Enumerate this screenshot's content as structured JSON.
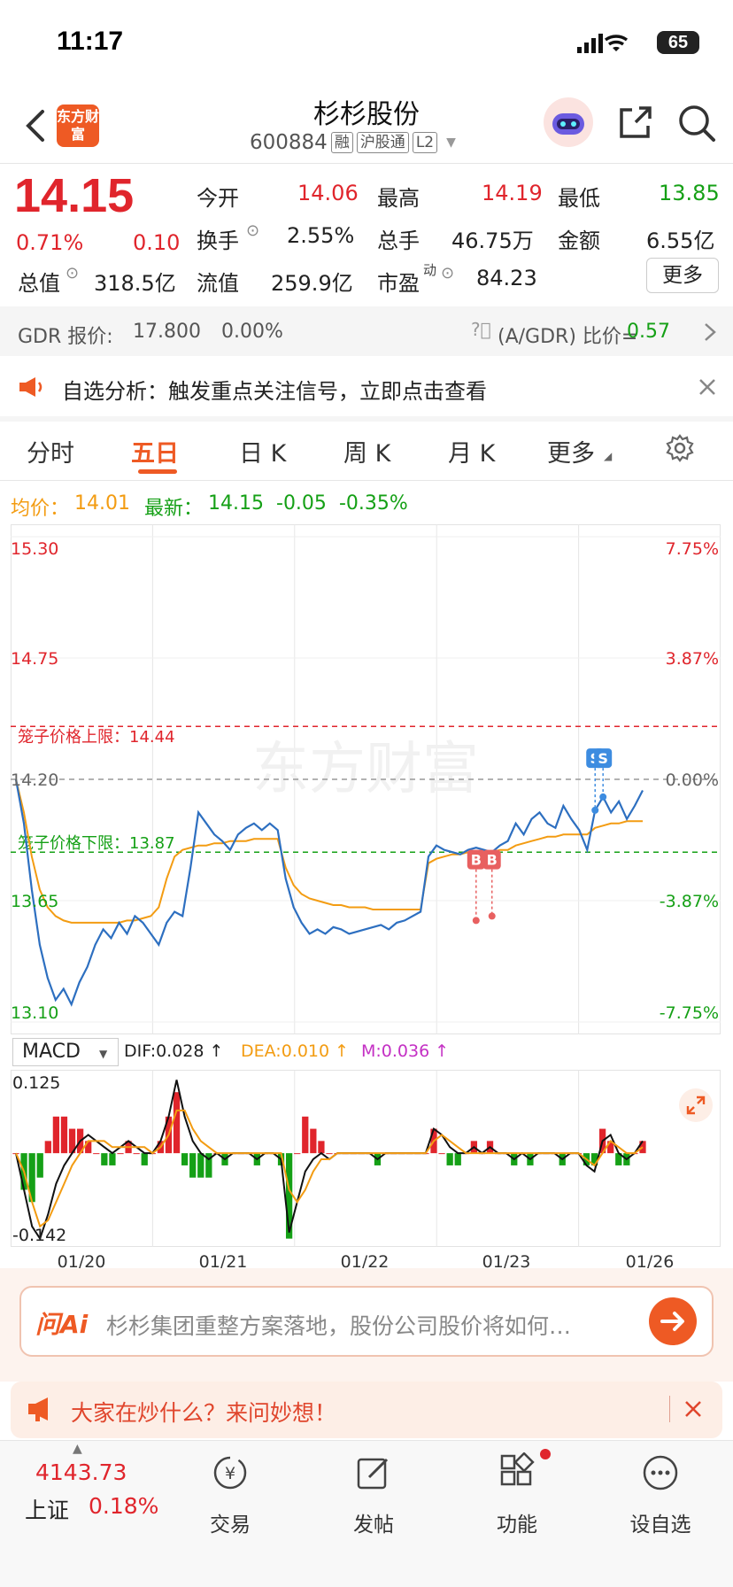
{
  "status": {
    "time": "11:17",
    "battery": "65"
  },
  "header": {
    "title": "杉杉股份",
    "code": "600884",
    "tags": [
      "融",
      "沪股通",
      "L2"
    ],
    "logo_text": "东方财富"
  },
  "quote": {
    "price": "14.15",
    "change_pct": "0.71%",
    "change": "0.10",
    "stats": [
      {
        "label": "今开",
        "value": "14.06",
        "color": "#e0252c"
      },
      {
        "label": "最高",
        "value": "14.19",
        "color": "#e0252c"
      },
      {
        "label": "最低",
        "value": "13.85",
        "color": "#15a016"
      },
      {
        "label": "换手",
        "value": "2.55%",
        "color": "#222"
      },
      {
        "label": "总手",
        "value": "46.75万",
        "color": "#222"
      },
      {
        "label": "金额",
        "value": "6.55亿",
        "color": "#222"
      },
      {
        "label": "总值",
        "value": "318.5亿",
        "color": "#222"
      },
      {
        "label": "流值",
        "value": "259.9亿",
        "color": "#222"
      },
      {
        "label": "市盈",
        "label_sup": "动",
        "value": "84.23",
        "color": "#222"
      }
    ],
    "more_label": "更多"
  },
  "gdr": {
    "label": "GDR 报价:",
    "price": "17.800",
    "pct": "0.00%",
    "ratio_label": "(A/GDR) 比价=",
    "ratio": "0.57"
  },
  "notice": {
    "text": "自选分析：触发重点关注信号，立即点击查看"
  },
  "tabs": [
    "分时",
    "五日",
    "日 K",
    "周 K",
    "月 K",
    "更多"
  ],
  "active_tab": "五日",
  "chart_info": {
    "avg_label": "均价：",
    "avg": "14.01",
    "latest_label": "最新：",
    "latest": "14.15",
    "chg": "-0.05",
    "chg_pct": "-0.35%"
  },
  "chart_data": {
    "type": "line",
    "y_left_ticks": [
      "15.30",
      "14.75",
      "14.20",
      "13.65",
      "13.10"
    ],
    "y_right_ticks": [
      "7.75%",
      "3.87%",
      "0.00%",
      "-3.87%",
      "-7.75%"
    ],
    "ylim": [
      13.1,
      15.3
    ],
    "upper_limit_label": "笼子价格上限：14.44",
    "upper_limit": 14.44,
    "lower_limit_label": "笼子价格下限：13.87",
    "lower_limit": 13.87,
    "base_price": 14.2,
    "x_labels": [
      "01/20",
      "01/21",
      "01/22",
      "01/23",
      "01/26"
    ],
    "watermark": "东方财富",
    "series": [
      {
        "name": "最新",
        "color": "#2d6fc0",
        "values": [
          14.2,
          14.0,
          13.7,
          13.45,
          13.3,
          13.2,
          13.25,
          13.18,
          13.28,
          13.35,
          13.45,
          13.52,
          13.48,
          13.55,
          13.5,
          13.58,
          13.55,
          13.5,
          13.45,
          13.55,
          13.6,
          13.58,
          13.8,
          14.05,
          14.0,
          13.95,
          13.92,
          13.88,
          13.95,
          13.98,
          14.0,
          13.97,
          14.0,
          13.97,
          13.75,
          13.62,
          13.55,
          13.5,
          13.52,
          13.5,
          13.53,
          13.52,
          13.5,
          13.51,
          13.52,
          13.53,
          13.54,
          13.52,
          13.55,
          13.56,
          13.58,
          13.6,
          13.85,
          13.9,
          13.88,
          13.87,
          13.86,
          13.88,
          13.89,
          13.88,
          13.87,
          13.9,
          13.92,
          14.0,
          13.95,
          14.02,
          14.05,
          14.0,
          13.98,
          14.08,
          14.02,
          13.97,
          13.88,
          14.06,
          14.12,
          14.05,
          14.1,
          14.02,
          14.08,
          14.15
        ]
      },
      {
        "name": "均价",
        "color": "#f39c12",
        "values": [
          14.2,
          14.05,
          13.85,
          13.7,
          13.62,
          13.58,
          13.56,
          13.55,
          13.55,
          13.55,
          13.55,
          13.55,
          13.55,
          13.55,
          13.56,
          13.56,
          13.57,
          13.58,
          13.62,
          13.75,
          13.85,
          13.88,
          13.89,
          13.9,
          13.9,
          13.91,
          13.91,
          13.92,
          13.92,
          13.92,
          13.93,
          13.93,
          13.93,
          13.93,
          13.8,
          13.72,
          13.68,
          13.66,
          13.65,
          13.64,
          13.63,
          13.63,
          13.62,
          13.62,
          13.62,
          13.61,
          13.61,
          13.61,
          13.61,
          13.61,
          13.61,
          13.61,
          13.82,
          13.84,
          13.85,
          13.86,
          13.86,
          13.87,
          13.87,
          13.87,
          13.87,
          13.88,
          13.88,
          13.9,
          13.91,
          13.92,
          13.93,
          13.94,
          13.94,
          13.95,
          13.95,
          13.95,
          13.95,
          13.98,
          13.99,
          14.0,
          14.0,
          14.01,
          14.01,
          14.01
        ]
      }
    ],
    "markers": [
      {
        "label": "B",
        "x_index": 58,
        "value": 13.56,
        "color": "#e86060"
      },
      {
        "label": "B",
        "x_index": 60,
        "value": 13.58,
        "color": "#e86060"
      },
      {
        "label": "S",
        "x_index": 73,
        "value": 14.06,
        "color": "#3d8ce0"
      },
      {
        "label": "S",
        "x_index": 74,
        "value": 14.12,
        "color": "#3d8ce0"
      }
    ]
  },
  "macd": {
    "indicator": "MACD",
    "dif_label": "DIF:0.028 ↑",
    "dea_label": "DEA:0.010 ↑",
    "m_label": "M:0.036 ↑",
    "y_top": "0.125",
    "y_bottom": "-0.142",
    "dif": [
      0.0,
      -0.06,
      -0.12,
      -0.14,
      -0.1,
      -0.05,
      -0.02,
      0.0,
      0.02,
      0.03,
      0.02,
      0.01,
      0.0,
      0.01,
      0.02,
      0.01,
      0.0,
      0.0,
      0.02,
      0.06,
      0.12,
      0.06,
      0.02,
      0.0,
      -0.01,
      0.0,
      -0.01,
      0.0,
      0.0,
      0.0,
      -0.01,
      0.0,
      0.0,
      -0.01,
      -0.13,
      -0.08,
      -0.03,
      -0.01,
      0.0,
      -0.01,
      0.0,
      0.0,
      0.0,
      0.0,
      0.0,
      -0.01,
      0.0,
      0.0,
      0.0,
      0.0,
      0.0,
      0.0,
      0.04,
      0.03,
      0.01,
      0.0,
      0.0,
      0.01,
      0.0,
      0.01,
      0.0,
      0.0,
      -0.01,
      0.0,
      -0.01,
      0.0,
      0.0,
      0.0,
      -0.01,
      0.0,
      0.0,
      -0.02,
      -0.03,
      0.02,
      0.03,
      0.0,
      -0.01,
      0.0,
      0.02
    ],
    "dea": [
      0.0,
      -0.03,
      -0.08,
      -0.12,
      -0.11,
      -0.08,
      -0.05,
      -0.02,
      0.0,
      0.02,
      0.02,
      0.02,
      0.01,
      0.01,
      0.01,
      0.01,
      0.01,
      0.0,
      0.01,
      0.03,
      0.07,
      0.07,
      0.04,
      0.02,
      0.01,
      0.0,
      0.0,
      0.0,
      0.0,
      0.0,
      0.0,
      0.0,
      0.0,
      0.0,
      -0.06,
      -0.08,
      -0.06,
      -0.03,
      -0.01,
      -0.01,
      0.0,
      0.0,
      0.0,
      0.0,
      0.0,
      0.0,
      0.0,
      0.0,
      0.0,
      0.0,
      0.0,
      0.0,
      0.02,
      0.03,
      0.02,
      0.01,
      0.0,
      0.0,
      0.0,
      0.0,
      0.0,
      0.0,
      0.0,
      0.0,
      0.0,
      0.0,
      0.0,
      0.0,
      0.0,
      0.0,
      0.0,
      -0.01,
      -0.02,
      0.0,
      0.02,
      0.01,
      0.0,
      0.0,
      0.01
    ]
  },
  "ask": {
    "brand": "问Ai",
    "text": "杉杉集团重整方案落地，股份公司股价将如何…"
  },
  "hot": {
    "text": "大家在炒什么？来问妙想！"
  },
  "index_ticker": {
    "value": "4143.73",
    "name": "上证",
    "pct": "0.18%"
  },
  "nav": [
    {
      "label": "交易",
      "icon": "trade-icon"
    },
    {
      "label": "发帖",
      "icon": "post-icon"
    },
    {
      "label": "功能",
      "icon": "function-icon"
    },
    {
      "label": "设自选",
      "icon": "add-watch-icon"
    }
  ]
}
